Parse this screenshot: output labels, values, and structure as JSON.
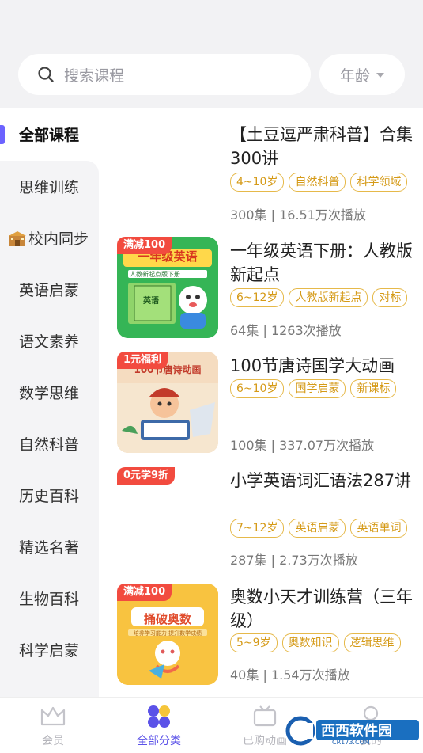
{
  "search": {
    "placeholder": "搜索课程",
    "age_label": "年龄"
  },
  "sidebar": {
    "items": [
      {
        "label": "全部课程"
      },
      {
        "label": "思维训练"
      },
      {
        "label": "校内同步"
      },
      {
        "label": "英语启蒙"
      },
      {
        "label": "语文素养"
      },
      {
        "label": "数学思维"
      },
      {
        "label": "自然科普"
      },
      {
        "label": "历史百科"
      },
      {
        "label": "精选名著"
      },
      {
        "label": "生物百科"
      },
      {
        "label": "科学启蒙"
      }
    ]
  },
  "courses": [
    {
      "title": "【土豆逗严肃科普】合集300讲",
      "tags": [
        "4~10岁",
        "自然科普",
        "科学领域"
      ],
      "episodes": "300集",
      "plays": "16.51万次播放"
    },
    {
      "badge": "满减100",
      "thumb_text": "一年级英语",
      "thumb_sub": "人教新起点版下册",
      "thumb_book": "英语",
      "title": "一年级英语下册：人教版新起点",
      "tags": [
        "6~12岁",
        "人教版新起点",
        "对标"
      ],
      "episodes": "64集",
      "plays": "1263次播放"
    },
    {
      "badge": "1元福利",
      "thumb_text": "100节唐诗动画",
      "title": "100节唐诗国学大动画",
      "tags": [
        "6~10岁",
        "国学启蒙",
        "新课标"
      ],
      "episodes": "100集",
      "plays": "337.07万次播放"
    },
    {
      "badge": "0元学9折",
      "title": "小学英语词汇语法287讲",
      "tags": [
        "7~12岁",
        "英语启蒙",
        "英语单词"
      ],
      "episodes": "287集",
      "plays": "2.73万次播放"
    },
    {
      "badge": "满减100",
      "thumb_text": "捅破奥数",
      "thumb_sub": "培养学习能力 提升数学成绩",
      "title": "奥数小天才训练营（三年级）",
      "tags": [
        "5~9岁",
        "奥数知识",
        "逻辑思维"
      ],
      "episodes": "40集",
      "plays": "1.54万次播放"
    }
  ],
  "tabs": [
    {
      "label": "会员"
    },
    {
      "label": "全部分类"
    },
    {
      "label": "已购动画"
    },
    {
      "label": "我的"
    }
  ],
  "watermark": {
    "text": "西西软件园",
    "sub": "CR173.COM"
  },
  "colors": {
    "accent": "#5b52e8",
    "tag": "#d59a17",
    "badge": "#f24b3f"
  }
}
